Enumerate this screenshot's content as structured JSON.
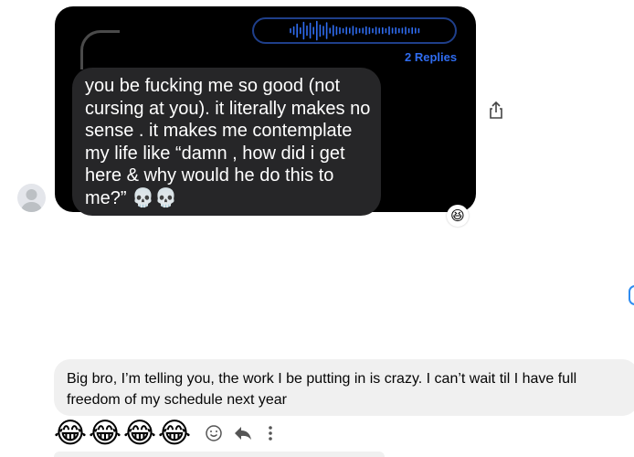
{
  "shared_post": {
    "replies_label": "2 Replies",
    "message_text": "you be fucking me so good (not cursing at you). it literally makes no sense . it makes me contemplate my life like “damn , how did i get here & why would he do this to me?” 💀💀",
    "reaction_emoji": "😆"
  },
  "message": {
    "text": "Big bro, I’m telling you, the work I be putting in is crazy. I can’t wait til I have full freedom of my schedule next year"
  },
  "reactions": {
    "emojis": [
      "😂",
      "😂",
      "😂",
      "😂"
    ]
  },
  "icons": {
    "share": "share-icon",
    "react": "smiley-icon",
    "reply": "reply-icon",
    "more": "more-icon",
    "avatar": "avatar-placeholder"
  },
  "colors": {
    "link_blue": "#2f6cf0",
    "bubble_gray": "#f0f0f0",
    "dark_card": "#000000",
    "inner_bubble": "#262628"
  }
}
